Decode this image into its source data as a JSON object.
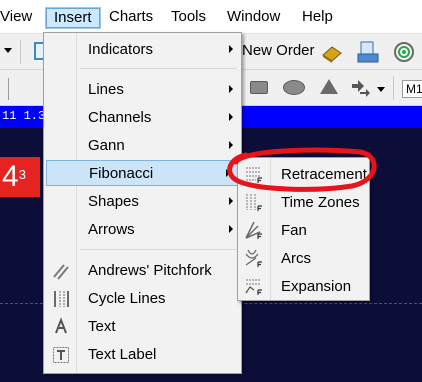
{
  "menubar": {
    "items": [
      {
        "label": "View"
      },
      {
        "label": "Insert"
      },
      {
        "label": "Charts"
      },
      {
        "label": "Tools"
      },
      {
        "label": "Window"
      },
      {
        "label": "Help"
      }
    ]
  },
  "toolbar": {
    "new_order_label": "New Order",
    "m1_label": "M1"
  },
  "chart": {
    "symbol_text": "11  1.39",
    "price_big": "4",
    "price_sup": "3"
  },
  "insert_menu": {
    "indicators": "Indicators",
    "lines": "Lines",
    "channels": "Channels",
    "gann": "Gann",
    "fibonacci": "Fibonacci",
    "shapes": "Shapes",
    "arrows": "Arrows",
    "andrews_pitchfork": "Andrews' Pitchfork",
    "cycle_lines": "Cycle Lines",
    "text": "Text",
    "text_label": "Text Label"
  },
  "fibonacci_submenu": {
    "retracement": "Retracement",
    "time_zones": "Time Zones",
    "fan": "Fan",
    "arcs": "Arcs",
    "expansion": "Expansion"
  },
  "colors": {
    "highlight": "#cce4f7",
    "annotation": "#e8141c",
    "chart_bg": "#0d0d3a",
    "blue_bar": "#0000ff",
    "price_box": "#e52421"
  }
}
